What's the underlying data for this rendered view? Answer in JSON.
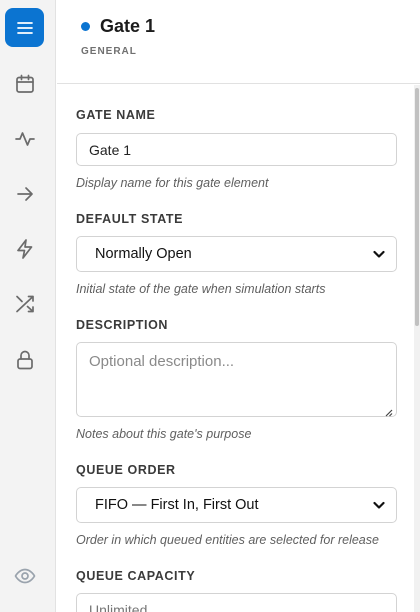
{
  "header": {
    "title": "Gate 1",
    "subtitle": "GENERAL",
    "status_color": "#0b74d1"
  },
  "rail": {
    "items": [
      {
        "icon": "menu-icon",
        "active": true
      },
      {
        "icon": "calendar-icon",
        "active": false
      },
      {
        "icon": "activity-icon",
        "active": false
      },
      {
        "icon": "arrow-right-icon",
        "active": false
      },
      {
        "icon": "lightning-icon",
        "active": false
      },
      {
        "icon": "shuffle-icon",
        "active": false
      },
      {
        "icon": "lock-icon",
        "active": false
      }
    ],
    "bottom_icon": "eye-icon",
    "accent": "#0b74d1"
  },
  "form": {
    "gate_name": {
      "label": "GATE NAME",
      "value": "Gate 1",
      "help": "Display name for this gate element"
    },
    "default_state": {
      "label": "DEFAULT STATE",
      "value": "Normally Open",
      "help": "Initial state of the gate when simulation starts"
    },
    "description": {
      "label": "DESCRIPTION",
      "placeholder": "Optional description...",
      "help": "Notes about this gate's purpose"
    },
    "queue_order": {
      "label": "QUEUE ORDER",
      "value": "FIFO — First In, First Out",
      "help": "Order in which queued entities are selected for release"
    },
    "queue_capacity": {
      "label": "QUEUE CAPACITY",
      "placeholder": "Unlimited"
    }
  }
}
